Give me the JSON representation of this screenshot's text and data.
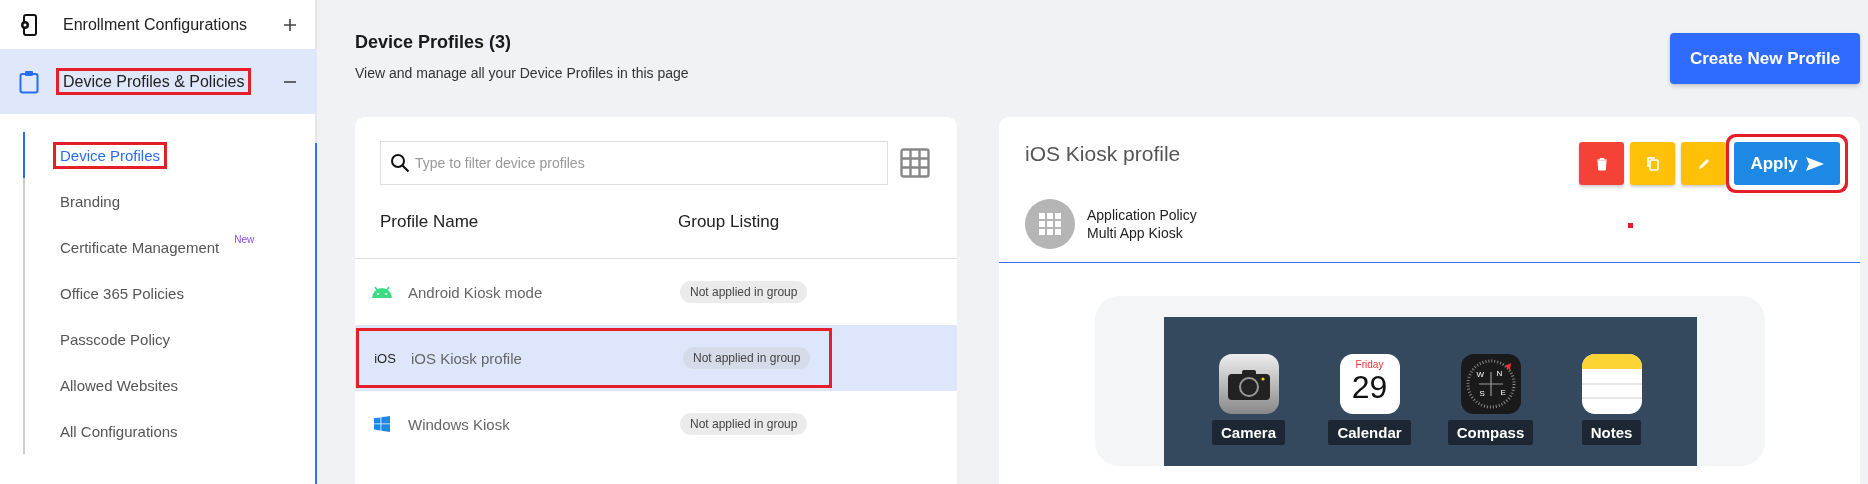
{
  "sidebar": {
    "sections": [
      {
        "kind": "enrollment",
        "label": "Enrollment Configurations",
        "expanded": false,
        "selected": false,
        "annotated": false
      },
      {
        "kind": "profiles",
        "label": "Device Profiles & Policies",
        "expanded": true,
        "selected": true,
        "annotated": true,
        "items": [
          {
            "label": "Device Profiles",
            "selected": true,
            "annotated": true
          },
          {
            "label": "Branding",
            "selected": false,
            "annotated": false
          },
          {
            "label": "Certificate Management",
            "badge": "New",
            "selected": false,
            "annotated": false
          },
          {
            "label": "Office 365 Policies",
            "selected": false,
            "annotated": false
          },
          {
            "label": "Passcode Policy",
            "selected": false,
            "annotated": false
          },
          {
            "label": "Allowed Websites",
            "selected": false,
            "annotated": false
          },
          {
            "label": "All Configurations",
            "selected": false,
            "annotated": false
          }
        ]
      }
    ]
  },
  "header": {
    "title": "Device Profiles (3)",
    "subtitle": "View and manage all your Device Profiles in this page",
    "button": "Create New Profile"
  },
  "profiles": {
    "search": {
      "placeholder": "Type to filter device profiles"
    },
    "columns": [
      "Profile Name",
      "Group Listing"
    ],
    "rows": [
      {
        "kind": "android",
        "name": "Android Kiosk mode",
        "group": "Not applied in group",
        "selected": false,
        "annotated": false
      },
      {
        "kind": "ios",
        "platform_label": "iOS",
        "name": "iOS Kiosk profile",
        "group": "Not applied in group",
        "selected": true,
        "annotated": true
      },
      {
        "kind": "windows",
        "name": "Windows Kiosk",
        "group": "Not applied in group",
        "selected": false,
        "annotated": false
      }
    ]
  },
  "detail": {
    "title": "iOS Kiosk profile",
    "actions": [
      {
        "kind": "delete",
        "annotated": false
      },
      {
        "kind": "copy",
        "annotated": false
      },
      {
        "kind": "edit",
        "annotated": false
      },
      {
        "kind": "apply",
        "label": "Apply",
        "annotated": true
      }
    ],
    "policy": {
      "title": "Application Policy",
      "subtitle": "Multi App Kiosk"
    },
    "apps": [
      {
        "kind": "camera",
        "label": "Camera"
      },
      {
        "kind": "calendar",
        "label": "Calendar",
        "day": "Friday",
        "date": "29"
      },
      {
        "kind": "compass",
        "label": "Compass",
        "marks": [
          "W",
          "N",
          "S",
          "E"
        ]
      },
      {
        "kind": "notes",
        "label": "Notes"
      }
    ]
  }
}
